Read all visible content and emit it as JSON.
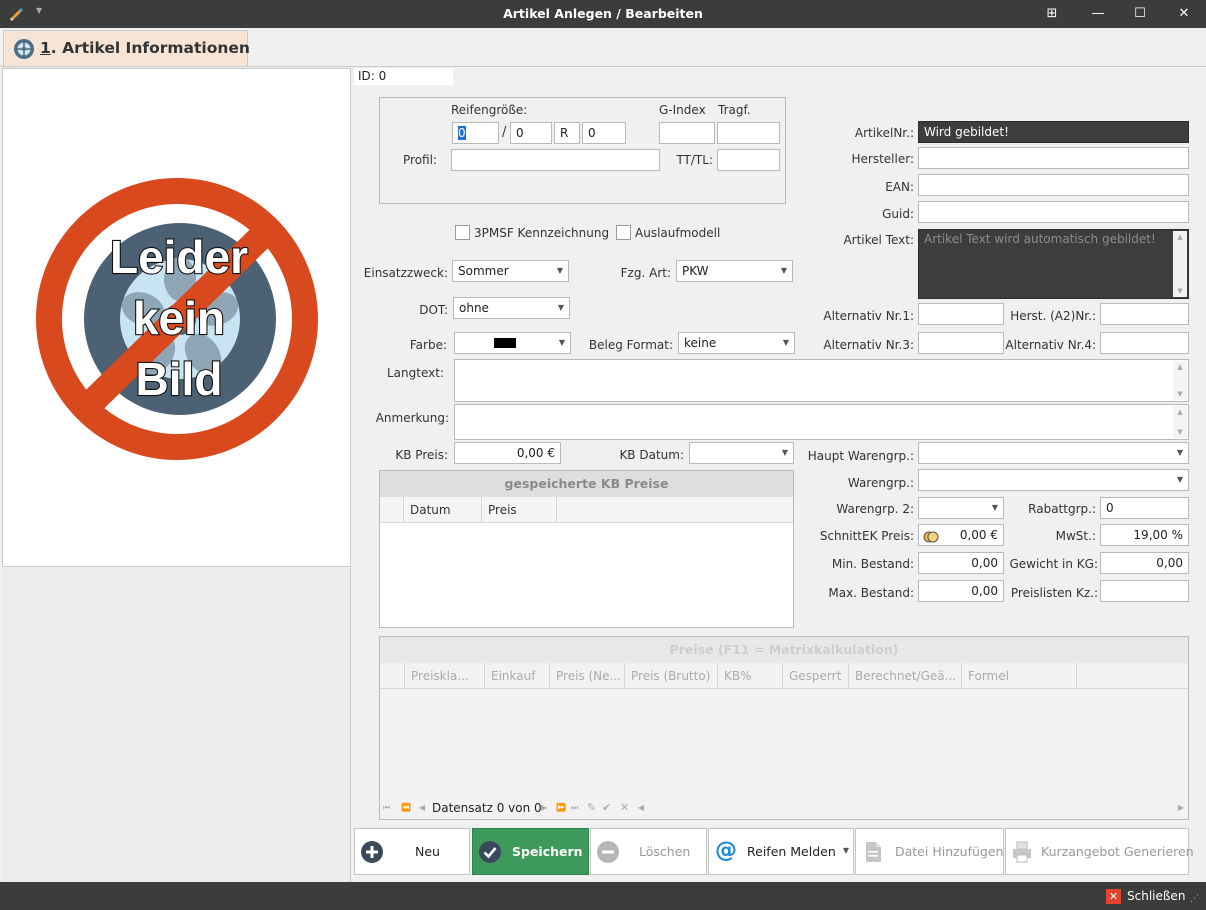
{
  "window": {
    "title": "Artikel Anlegen / Bearbeiten"
  },
  "tab": {
    "number": "1",
    "rest": ". Artikel Informationen"
  },
  "image": {
    "line1": "Leider",
    "line2": "kein",
    "line3": "Bild"
  },
  "id_label": "ID: 0",
  "tire": {
    "size_label": "Reifengröße:",
    "gindex_label": "G-Index",
    "tragf_label": "Tragf.",
    "width": "0",
    "slash": "/",
    "ratio": "0",
    "construction": "R",
    "diameter": "0",
    "profil_label": "Profil:",
    "tttl_label": "TT/TL:"
  },
  "checkboxes": {
    "pmsf": "3PMSF Kennzeichnung",
    "auslauf": "Auslaufmodell"
  },
  "fields": {
    "einsatz_label": "Einsatzzweck:",
    "einsatz_value": "Sommer",
    "fzg_label": "Fzg. Art:",
    "fzg_value": "PKW",
    "dot_label": "DOT:",
    "dot_value": "ohne",
    "farbe_label": "Farbe:",
    "farbe_color": "#000000",
    "beleg_label": "Beleg Format:",
    "beleg_value": "keine",
    "langtext_label": "Langtext:",
    "anmerkung_label": "Anmerkung:",
    "kbpreis_label": "KB Preis:",
    "kbpreis_value": "0,00 €",
    "kbdatum_label": "KB Datum:"
  },
  "kb_grid": {
    "title": "gespeicherte KB Preise",
    "columns": [
      "Datum",
      "Preis"
    ]
  },
  "right": {
    "artnr_label": "ArtikelNr.:",
    "artnr_value": "Wird gebildet!",
    "hersteller_label": "Hersteller:",
    "ean_label": "EAN:",
    "guid_label": "Guid:",
    "text_label": "Artikel Text:",
    "text_value": "Artikel Text wird automatisch gebildet!",
    "alt1_label": "Alternativ Nr.1:",
    "herst_a2_label": "Herst. (A2)Nr.:",
    "alt3_label": "Alternativ Nr.3:",
    "alt4_label": "Alternativ Nr.4:",
    "haupt_label": "Haupt Warengrp.:",
    "waren_label": "Warengrp.:",
    "waren2_label": "Warengrp. 2:",
    "rabatt_label": "Rabattgrp.:",
    "rabatt_value": "0",
    "schnitt_label": "SchnittEK Preis:",
    "schnitt_value": "0,00 €",
    "mwst_label": "MwSt.:",
    "mwst_value": "19,00 %",
    "minb_label": "Min. Bestand:",
    "minb_value": "0,00",
    "gewicht_label": "Gewicht in KG:",
    "gewicht_value": "0,00",
    "maxb_label": "Max. Bestand:",
    "maxb_value": "0,00",
    "preisl_label": "Preislisten Kz.:"
  },
  "price_grid": {
    "title": "Preise (F11 = Matrixkalkulation)",
    "columns": [
      "Preiskla...",
      "Einkauf",
      "Preis (Ne...",
      "Preis (Brutto)",
      "KB%",
      "Gesperrt",
      "Berechnet/Geä...",
      "Formel"
    ],
    "nav_text": "Datensatz 0 von 0"
  },
  "buttons": {
    "neu": "Neu",
    "speichern": "Speichern",
    "loeschen": "Löschen",
    "reifen": "Reifen Melden",
    "datei": "Datei Hinzufügen",
    "kurz": "Kurzangebot Generieren"
  },
  "status": {
    "close": "Schließen"
  },
  "colors": {
    "save_green": "#3d9a5c",
    "tab_bg": "#f6e4d6",
    "no_sign_red": "#d9491e"
  }
}
